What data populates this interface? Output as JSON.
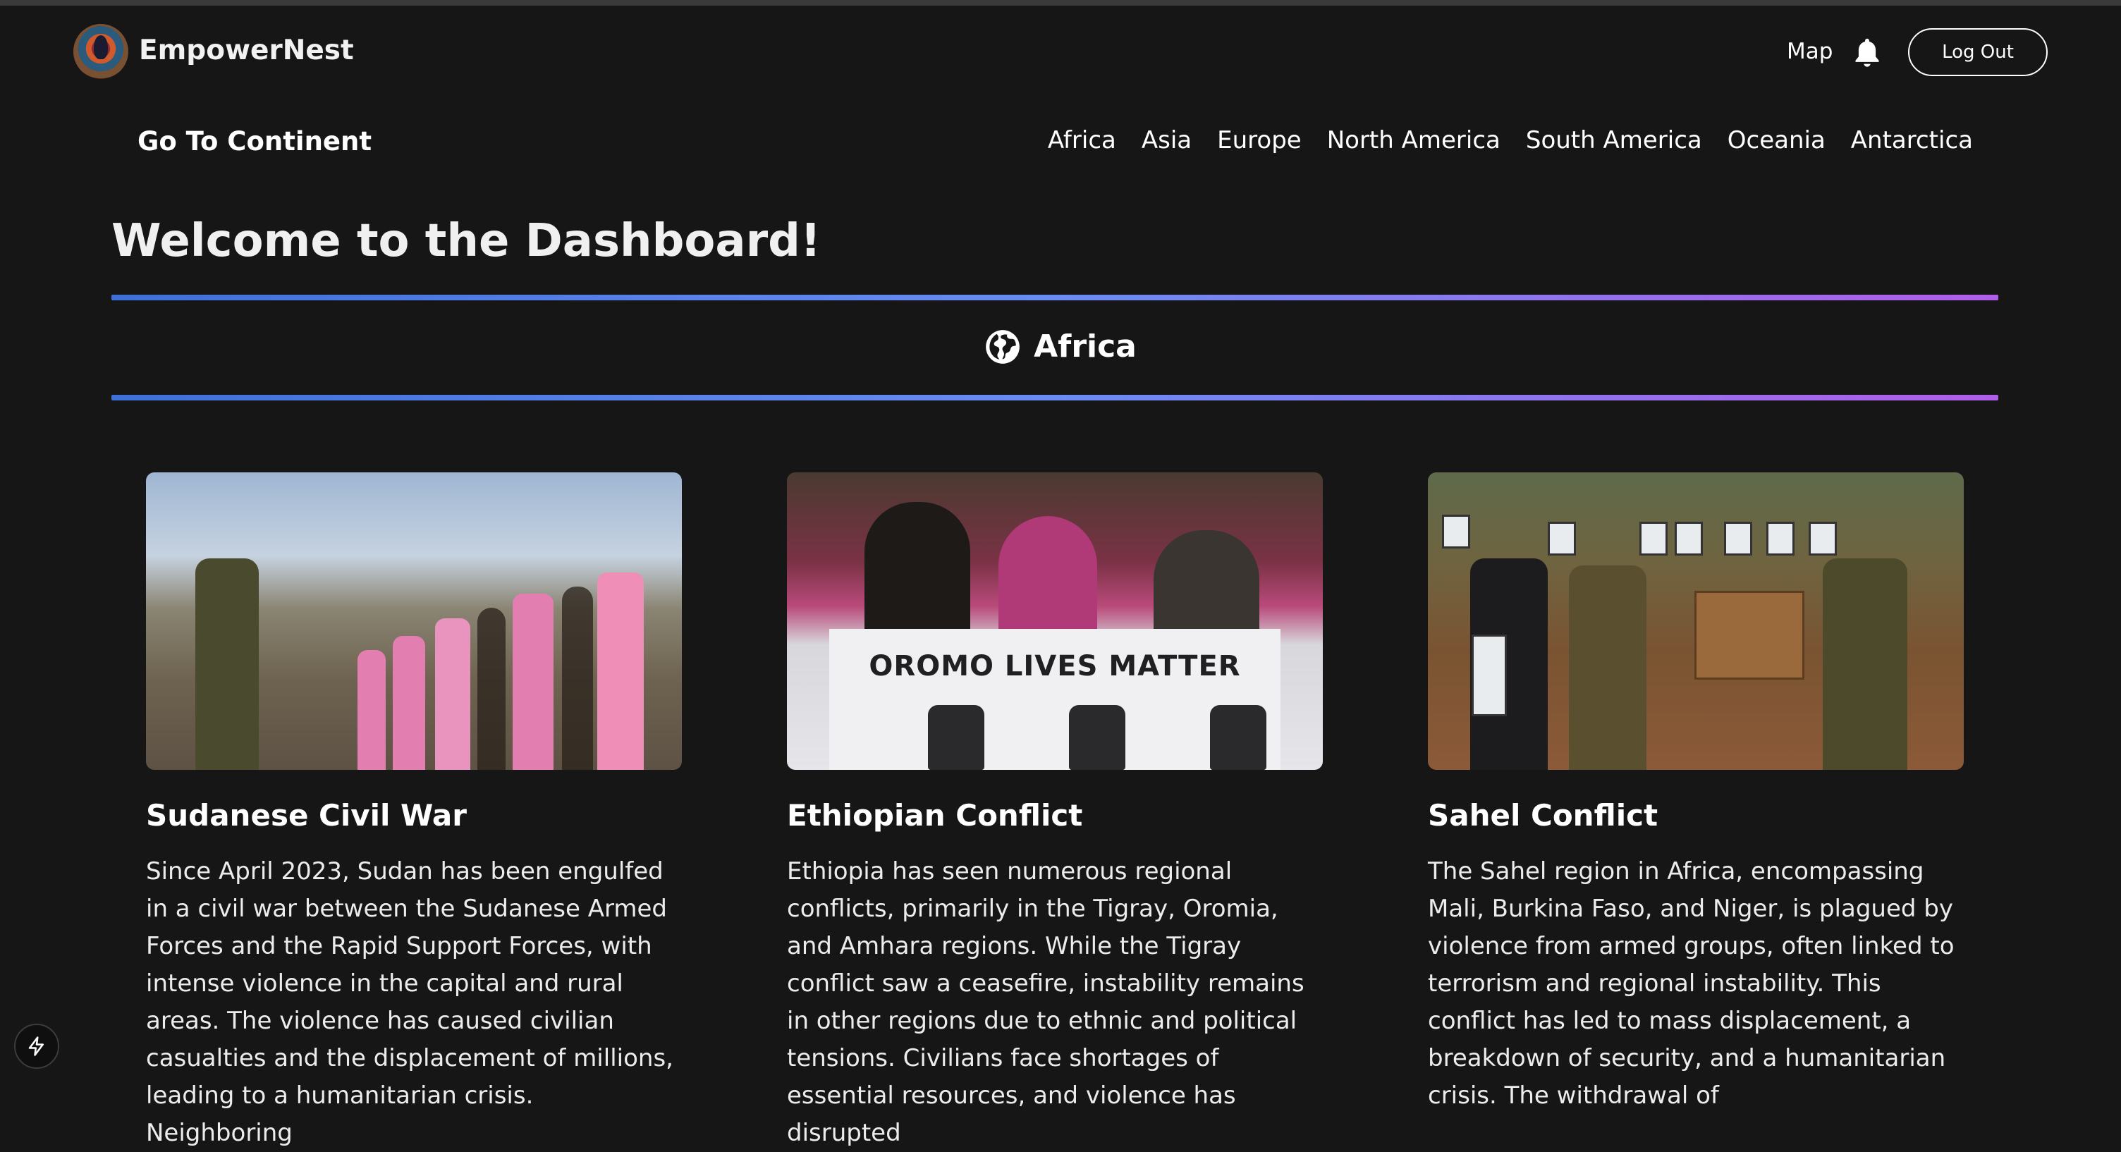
{
  "header": {
    "brand": "EmpowerNest",
    "map_link": "Map",
    "logout_label": "Log Out"
  },
  "continent_nav": {
    "label": "Go To Continent",
    "items": [
      "Africa",
      "Asia",
      "Europe",
      "North America",
      "South America",
      "Oceania",
      "Antarctica"
    ]
  },
  "welcome": "Welcome to the Dashboard!",
  "section": {
    "title": "Africa",
    "icon": "globe-icon"
  },
  "cards": [
    {
      "title": "Sudanese Civil War",
      "body": "Since April 2023, Sudan has been engulfed in a civil war between the Sudanese Armed Forces and the Rapid Support Forces, with intense violence in the capital and rural areas. The violence has caused civilian casualties and the displacement of millions, leading to a humanitarian crisis. Neighboring"
    },
    {
      "title": "Ethiopian Conflict",
      "body": "Ethiopia has seen numerous regional conflicts, primarily in the Tigray, Oromia, and Amhara regions. While the Tigray conflict saw a ceasefire, instability remains in other regions due to ethnic and political tensions. Civilians face shortages of essential resources, and violence has disrupted",
      "image_banner": "OROMO LIVES MATTER"
    },
    {
      "title": "Sahel Conflict",
      "body": "The Sahel region in Africa, encompassing Mali, Burkina Faso, and Niger, is plagued by violence from armed groups, often linked to terrorism and regional instability. This conflict has led to mass displacement, a breakdown of security, and a humanitarian crisis. The withdrawal of"
    }
  ],
  "colors": {
    "background": "#161617",
    "rule_start": "#3e70d8",
    "rule_end": "#b05ee8"
  }
}
